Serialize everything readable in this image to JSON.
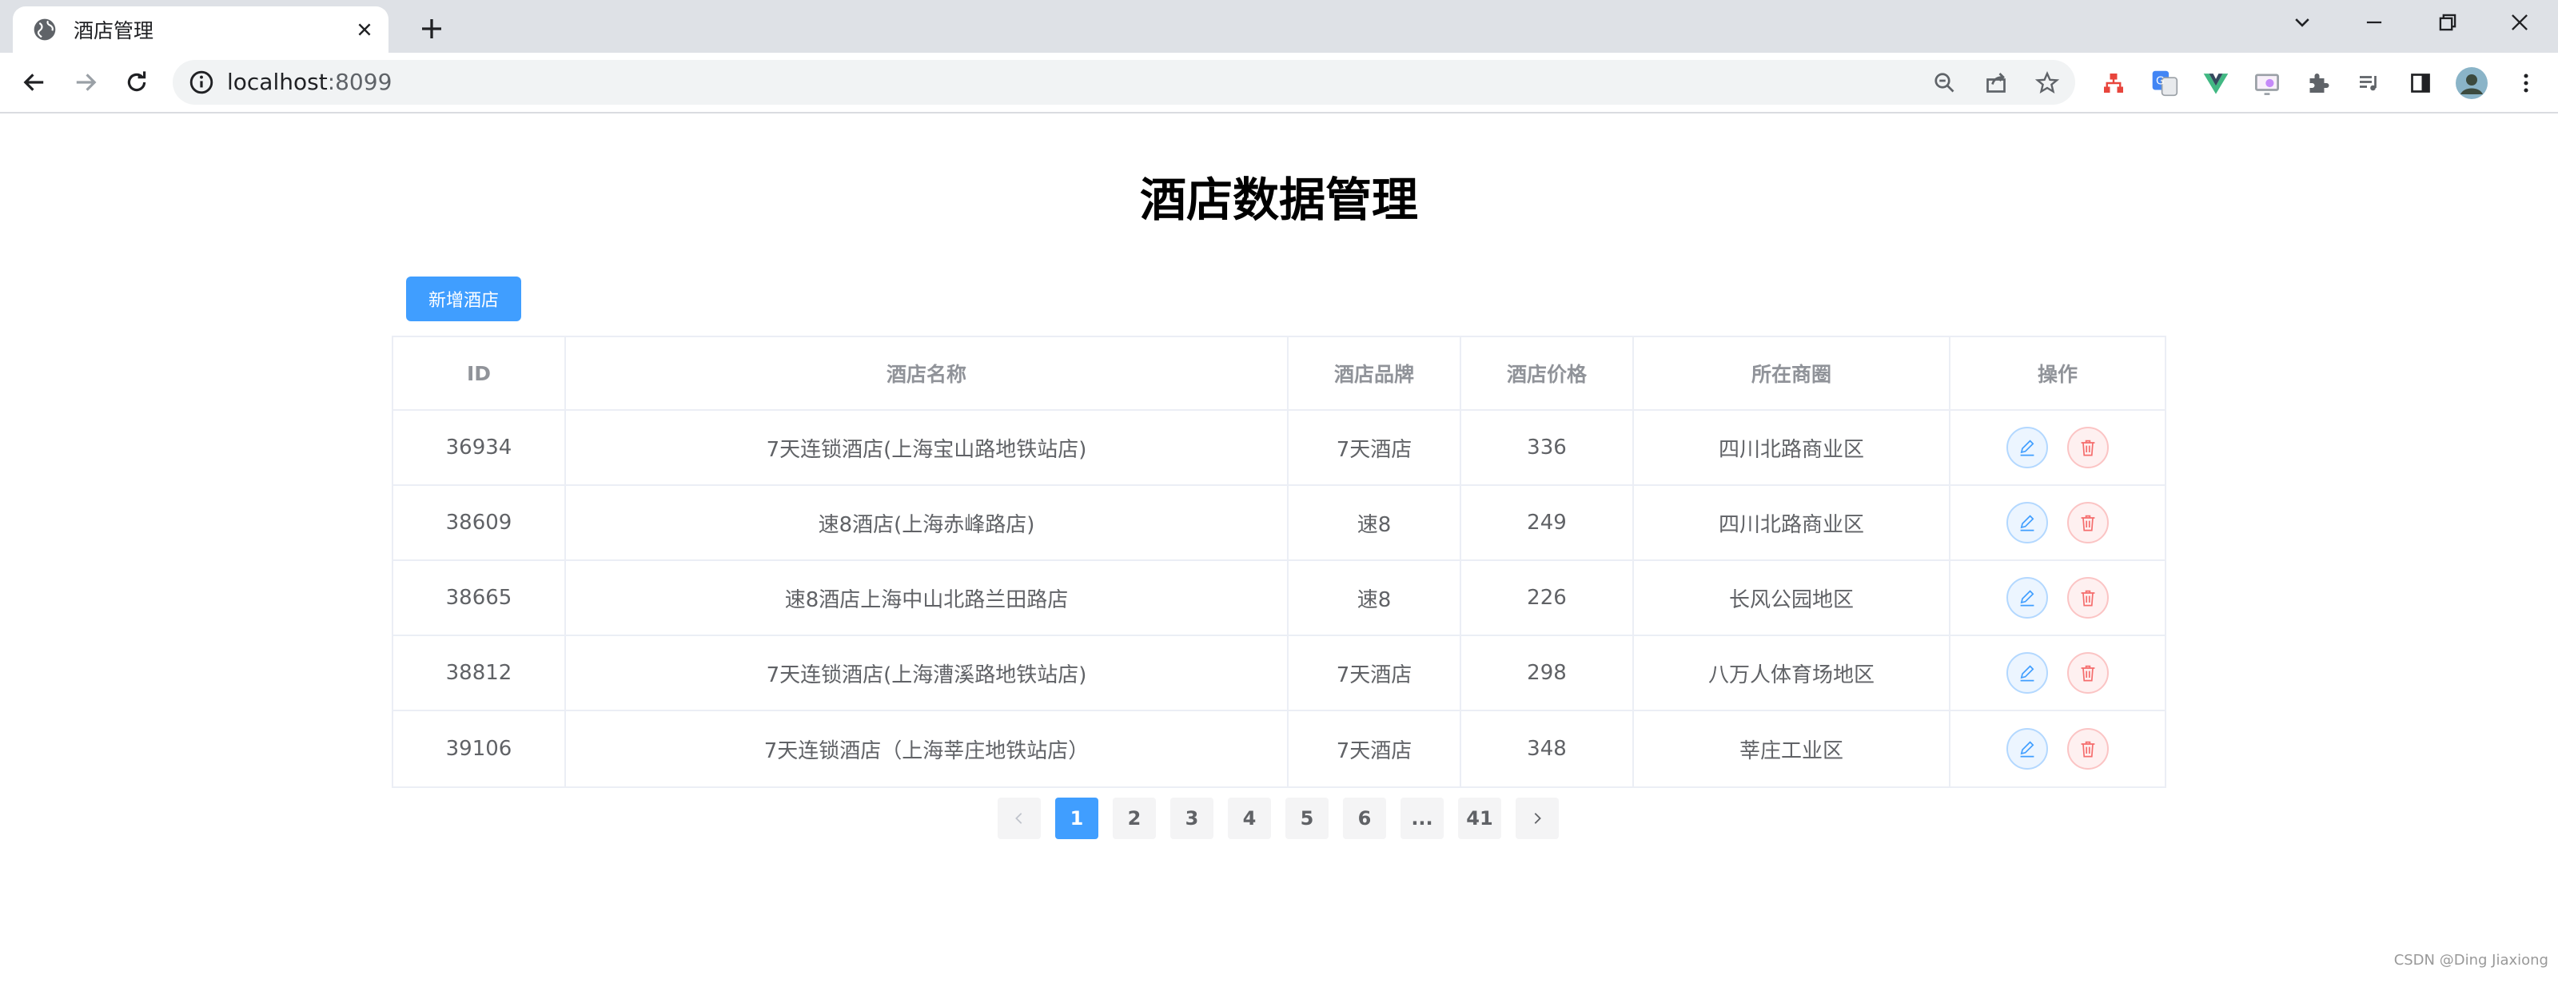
{
  "browser": {
    "tab_title": "酒店管理",
    "url_host": "localhost",
    "url_port": ":8099"
  },
  "page": {
    "title": "酒店数据管理",
    "add_button": "新增酒店"
  },
  "table": {
    "headers": [
      "ID",
      "酒店名称",
      "酒店品牌",
      "酒店价格",
      "所在商圈",
      "操作"
    ],
    "rows": [
      {
        "id": "36934",
        "name": "7天连锁酒店(上海宝山路地铁站店)",
        "brand": "7天酒店",
        "price": "336",
        "area": "四川北路商业区"
      },
      {
        "id": "38609",
        "name": "速8酒店(上海赤峰路店)",
        "brand": "速8",
        "price": "249",
        "area": "四川北路商业区"
      },
      {
        "id": "38665",
        "name": "速8酒店上海中山北路兰田路店",
        "brand": "速8",
        "price": "226",
        "area": "长风公园地区"
      },
      {
        "id": "38812",
        "name": "7天连锁酒店(上海漕溪路地铁站店)",
        "brand": "7天酒店",
        "price": "298",
        "area": "八万人体育场地区"
      },
      {
        "id": "39106",
        "name": "7天连锁酒店（上海莘庄地铁站店）",
        "brand": "7天酒店",
        "price": "348",
        "area": "莘庄工业区"
      }
    ]
  },
  "pagination": {
    "prev_icon": "chevron-left-icon",
    "pages": [
      "1",
      "2",
      "3",
      "4",
      "5",
      "6",
      "...",
      "41"
    ],
    "current": "1",
    "next_icon": "chevron-right-icon"
  },
  "colors": {
    "primary": "#409eff",
    "danger": "#f56c6c",
    "header_text": "#909399",
    "body_text": "#606266"
  },
  "watermark": "CSDN @Ding Jiaxiong"
}
